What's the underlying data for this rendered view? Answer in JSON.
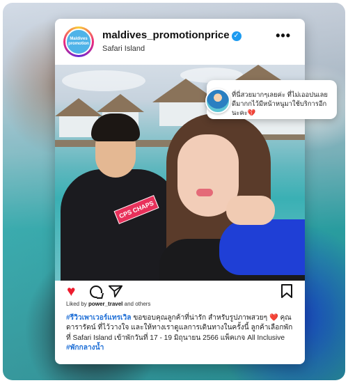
{
  "post": {
    "username": "maldives_promotionprice",
    "location": "Safari Island",
    "avatar_text_line1": "Maldives",
    "avatar_text_line2": "promotion",
    "more_label": "•••",
    "photo_tag": "CPS CHAPS",
    "liked_prefix": "Liked by",
    "liked_user": "power_travel",
    "liked_suffix": "and others",
    "caption": {
      "hashtag1": "#รีวิวเพาเวอร์แทรเวิล",
      "text1": " ขอขอบคุณลูกค้าที่น่ารัก สำหรับรูปภาพสวยๆ",
      "text2": " คุณ ดารารัตน์ ที่ไว้วางใจ และให้ทางเราดูแลการเดินทางในครั้งนี้ ลูกค้าเลือกพัก ที่ Safari Island เข้าพักวันที่ 17 - 19 มิถุนายน 2566 แพ็คเกจ All Inclusive ",
      "hashtag2": "#พักกลางน้ำ"
    }
  },
  "comment_bubble": {
    "text": "ที่นี่สวยมากๆเลยค่ะ ที่ไม่เออปนเลย ดีมากกไว้มีหน้าหนูมาใช้บริการอีกนะคะ💔"
  },
  "colors": {
    "like": "#ed1c2e",
    "hashtag": "#1f6fd6",
    "verified": "#1d9bf0",
    "sleeve_blue": "#1f3fd6"
  },
  "icons": [
    "heart-icon",
    "comment-icon",
    "share-icon",
    "save-icon",
    "verified-icon",
    "more-icon"
  ]
}
